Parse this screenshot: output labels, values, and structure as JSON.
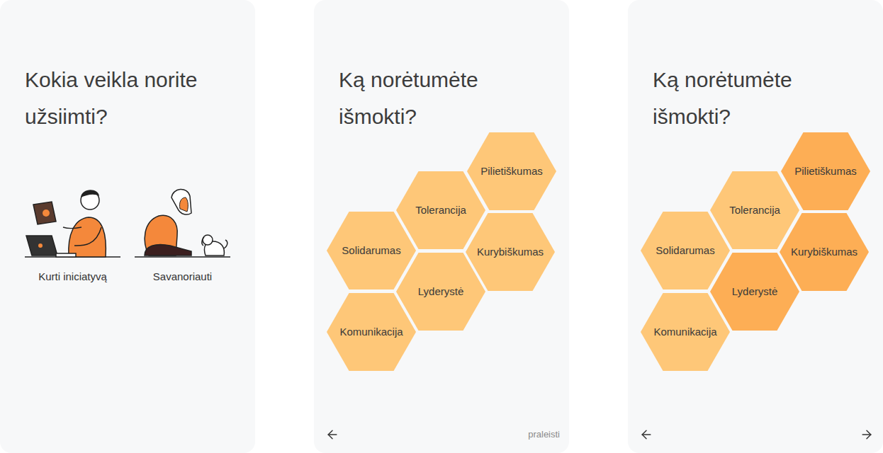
{
  "screens": [
    {
      "kind": "options",
      "title": "Kokia veikla norite užsiimti?",
      "options": [
        {
          "label": "Kurti iniciatyvą"
        },
        {
          "label": "Savanoriauti"
        }
      ]
    },
    {
      "kind": "skills",
      "title": "Ką norėtumėte išmokti?",
      "skills": [
        {
          "label": "Pilietiškumas",
          "selected": false
        },
        {
          "label": "Tolerancija",
          "selected": false
        },
        {
          "label": "Kurybiškumas",
          "selected": false
        },
        {
          "label": "Solidarumas",
          "selected": false
        },
        {
          "label": "Lyderystė",
          "selected": false
        },
        {
          "label": "Komunikacija",
          "selected": false
        }
      ],
      "nav": {
        "back": true,
        "skip": "praleisti",
        "next": false
      }
    },
    {
      "kind": "skills",
      "title": "Ką norėtumėte išmokti?",
      "skills": [
        {
          "label": "Pilietiškumas",
          "selected": true
        },
        {
          "label": "Tolerancija",
          "selected": false
        },
        {
          "label": "Kurybiškumas",
          "selected": true
        },
        {
          "label": "Solidarumas",
          "selected": false
        },
        {
          "label": "Lyderystė",
          "selected": true
        },
        {
          "label": "Komunikacija",
          "selected": false
        }
      ],
      "nav": {
        "back": true,
        "skip": "",
        "next": true
      }
    }
  ]
}
